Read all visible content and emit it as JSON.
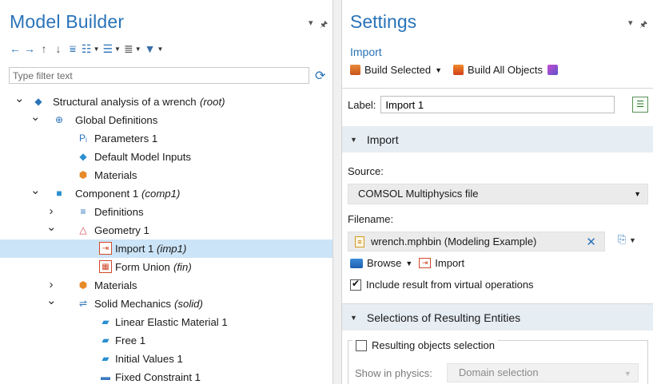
{
  "model_builder": {
    "title": "Model Builder",
    "filter_placeholder": "Type filter text",
    "tree": [
      {
        "label": "Structural analysis of a wrench",
        "tag": "(root)",
        "level": 0,
        "arrow": "down",
        "icon": "root-model-icon"
      },
      {
        "label": "Global Definitions",
        "tag": "",
        "level": 1,
        "arrow": "down",
        "icon": "globe-icon"
      },
      {
        "label": "Parameters 1",
        "tag": "",
        "level": 2,
        "arrow": "",
        "icon": "parameters-icon"
      },
      {
        "label": "Default Model Inputs",
        "tag": "",
        "level": 2,
        "arrow": "",
        "icon": "model-inputs-icon"
      },
      {
        "label": "Materials",
        "tag": "",
        "level": 2,
        "arrow": "",
        "icon": "materials-icon"
      },
      {
        "label": "Component 1",
        "tag": "(comp1)",
        "level": 1,
        "arrow": "down",
        "icon": "component-icon"
      },
      {
        "label": "Definitions",
        "tag": "",
        "level": 2,
        "arrow": "right",
        "icon": "definitions-icon"
      },
      {
        "label": "Geometry 1",
        "tag": "",
        "level": 2,
        "arrow": "down",
        "icon": "geometry-icon"
      },
      {
        "label": "Import 1",
        "tag": "(imp1)",
        "level": 3,
        "arrow": "",
        "icon": "import-icon",
        "selected": true
      },
      {
        "label": "Form Union",
        "tag": "(fin)",
        "level": 3,
        "arrow": "",
        "icon": "form-union-icon"
      },
      {
        "label": "Materials",
        "tag": "",
        "level": 2,
        "arrow": "right",
        "icon": "materials-icon"
      },
      {
        "label": "Solid Mechanics",
        "tag": "(solid)",
        "level": 2,
        "arrow": "down",
        "icon": "solid-mechanics-icon"
      },
      {
        "label": "Linear Elastic Material 1",
        "tag": "",
        "level": 3,
        "arrow": "",
        "icon": "physics-node-icon"
      },
      {
        "label": "Free 1",
        "tag": "",
        "level": 3,
        "arrow": "",
        "icon": "physics-node-icon"
      },
      {
        "label": "Initial Values 1",
        "tag": "",
        "level": 3,
        "arrow": "",
        "icon": "physics-node-icon"
      },
      {
        "label": "Fixed Constraint 1",
        "tag": "",
        "level": 3,
        "arrow": "",
        "icon": "constraint-icon"
      }
    ]
  },
  "settings": {
    "title": "Settings",
    "subtitle": "Import",
    "build_selected": "Build Selected",
    "build_all": "Build All Objects",
    "label_caption": "Label:",
    "label_value": "Import 1",
    "section_import": "Import",
    "source_caption": "Source:",
    "source_value": "COMSOL Multiphysics file",
    "filename_caption": "Filename:",
    "filename_value": "wrench.mphbin (Modeling Example)",
    "browse": "Browse",
    "import": "Import",
    "include_virtual": "Include result from virtual operations",
    "include_virtual_checked": true,
    "section_selections": "Selections of Resulting Entities",
    "resulting_objects": "Resulting objects selection",
    "resulting_objects_checked": false,
    "show_in_physics_caption": "Show in physics:",
    "show_in_physics_value": "Domain selection"
  },
  "colors": {
    "accent": "#2a73b8",
    "selection": "#cce4f7",
    "section_bg": "#e6edf3"
  }
}
